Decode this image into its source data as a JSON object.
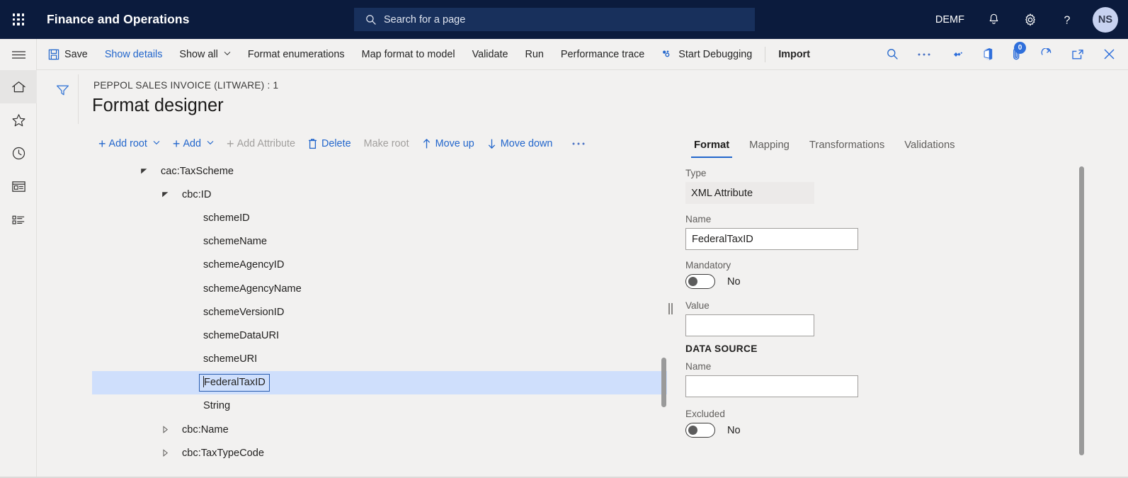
{
  "topnav": {
    "waffle_label": "app-launcher",
    "app_title": "Finance and Operations",
    "search_placeholder": "Search for a page",
    "company": "DEMF",
    "notifications_icon": "bell-icon",
    "settings_icon": "gear-icon",
    "help_icon": "question-mark-icon",
    "avatar_initials": "NS"
  },
  "rail": {
    "hamburger": "navigation-menu-icon",
    "items": [
      {
        "name": "home-icon",
        "active": true
      },
      {
        "name": "favorites-star-icon",
        "active": false
      },
      {
        "name": "recent-clock-icon",
        "active": false
      },
      {
        "name": "workspaces-icon",
        "active": false
      },
      {
        "name": "modules-list-icon",
        "active": false
      }
    ]
  },
  "commandbar": {
    "save": "Save",
    "show_details": "Show details",
    "show_all": "Show all",
    "format_enumerations": "Format enumerations",
    "map_format_to_model": "Map format to model",
    "validate": "Validate",
    "run": "Run",
    "performance_trace": "Performance trace",
    "start_debugging": "Start Debugging",
    "import": "Import",
    "search_icon": "search-icon",
    "overflow_icon": "ellipsis-icon",
    "share_icon": "share-diamond-icon",
    "office_icon": "open-in-office-icon",
    "attachments_icon": "attachment-icon",
    "attachments_count": "0",
    "refresh_icon": "refresh-icon",
    "popout_icon": "open-in-new-window-icon",
    "close_icon": "close-icon"
  },
  "page": {
    "filter_icon": "filter-icon",
    "breadcrumb": "PEPPOL SALES INVOICE (LITWARE) : 1",
    "title": "Format designer"
  },
  "actionbar": {
    "add_root": "Add root",
    "add": "Add",
    "add_attribute": "Add Attribute",
    "delete": "Delete",
    "make_root": "Make root",
    "move_up": "Move up",
    "move_down": "Move down",
    "overflow": "···"
  },
  "tree": {
    "nodes": [
      {
        "label": "cac:TaxScheme",
        "indent": 0,
        "twisty": "expanded",
        "selected": false,
        "editing": false
      },
      {
        "label": "cbc:ID",
        "indent": 1,
        "twisty": "expanded",
        "selected": false,
        "editing": false
      },
      {
        "label": "schemeID",
        "indent": 2,
        "twisty": "none",
        "selected": false,
        "editing": false
      },
      {
        "label": "schemeName",
        "indent": 2,
        "twisty": "none",
        "selected": false,
        "editing": false
      },
      {
        "label": "schemeAgencyID",
        "indent": 2,
        "twisty": "none",
        "selected": false,
        "editing": false
      },
      {
        "label": "schemeAgencyName",
        "indent": 2,
        "twisty": "none",
        "selected": false,
        "editing": false
      },
      {
        "label": "schemeVersionID",
        "indent": 2,
        "twisty": "none",
        "selected": false,
        "editing": false
      },
      {
        "label": "schemeDataURI",
        "indent": 2,
        "twisty": "none",
        "selected": false,
        "editing": false
      },
      {
        "label": "schemeURI",
        "indent": 2,
        "twisty": "none",
        "selected": false,
        "editing": false
      },
      {
        "label": "FederalTaxID",
        "indent": 2,
        "twisty": "none",
        "selected": true,
        "editing": true
      },
      {
        "label": "String",
        "indent": 2,
        "twisty": "none",
        "selected": false,
        "editing": false
      },
      {
        "label": "cbc:Name",
        "indent": 1,
        "twisty": "collapsed",
        "selected": false,
        "editing": false
      },
      {
        "label": "cbc:TaxTypeCode",
        "indent": 1,
        "twisty": "collapsed",
        "selected": false,
        "editing": false
      }
    ]
  },
  "details": {
    "tabs": [
      {
        "label": "Format",
        "active": true
      },
      {
        "label": "Mapping",
        "active": false
      },
      {
        "label": "Transformations",
        "active": false
      },
      {
        "label": "Validations",
        "active": false
      }
    ],
    "type_label": "Type",
    "type_value": "XML Attribute",
    "name_label": "Name",
    "name_value": "FederalTaxID",
    "mandatory_label": "Mandatory",
    "mandatory_value": "No",
    "value_label": "Value",
    "value_value": "",
    "datasource_section": "DATA SOURCE",
    "ds_name_label": "Name",
    "ds_name_value": "",
    "excluded_label": "Excluded",
    "excluded_value": "No"
  },
  "colors": {
    "navbar": "#0b1b3d",
    "accent": "#2266cc",
    "page_bg": "#f2f1f0",
    "selection": "#cfdffc",
    "badge": "#2f6fdb"
  }
}
